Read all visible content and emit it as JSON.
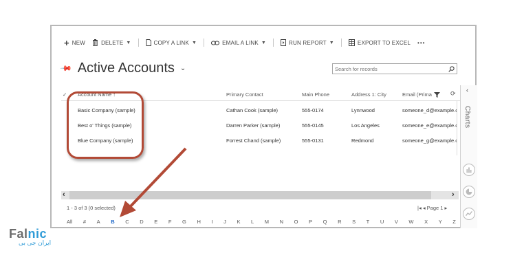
{
  "toolbar": {
    "new": "NEW",
    "delete": "DELETE",
    "copy_link": "COPY A LINK",
    "email_link": "EMAIL A LINK",
    "run_report": "RUN REPORT",
    "export_excel": "EXPORT TO EXCEL",
    "more": "•••"
  },
  "view": {
    "title": "Active Accounts"
  },
  "search": {
    "placeholder": "Search for records"
  },
  "grid": {
    "headers": [
      "Account Name",
      "Primary Contact",
      "Main Phone",
      "Address 1: City",
      "Email (Prima"
    ],
    "rows": [
      [
        "Basic Company (sample)",
        "Cathan Cook (sample)",
        "555-0174",
        "Lynnwood",
        "someone_d@example.c"
      ],
      [
        "Best o' Things (sample)",
        "Darren Parker (sample)",
        "555-0145",
        "Los Angeles",
        "someone_e@example.c"
      ],
      [
        "Blue Company (sample)",
        "Forrest Chand (sample)",
        "555-0131",
        "Redmond",
        "someone_g@example.c"
      ]
    ]
  },
  "footer": {
    "count": "1 - 3 of 3 (0 selected)",
    "page": "Page 1"
  },
  "alphabet": [
    "All",
    "#",
    "A",
    "B",
    "C",
    "D",
    "E",
    "F",
    "G",
    "H",
    "I",
    "J",
    "K",
    "L",
    "M",
    "N",
    "O",
    "P",
    "Q",
    "R",
    "S",
    "T",
    "U",
    "V",
    "W",
    "X",
    "Y",
    "Z"
  ],
  "alphabet_selected": "B",
  "side_panel": {
    "label": "Charts"
  },
  "logo": {
    "brand_a": "Fal",
    "brand_b": "nic",
    "sub": "ایران جی بی"
  },
  "colors": {
    "annotation": "#b24a36",
    "selected_letter": "#1c66c8",
    "brand_blue": "#2f9bd7"
  },
  "icons": [
    "plus-icon",
    "trash-icon",
    "copy-icon",
    "link-icon",
    "report-icon",
    "excel-icon",
    "pin-icon",
    "search-icon",
    "filter-icon",
    "refresh-icon",
    "chart-icon"
  ]
}
